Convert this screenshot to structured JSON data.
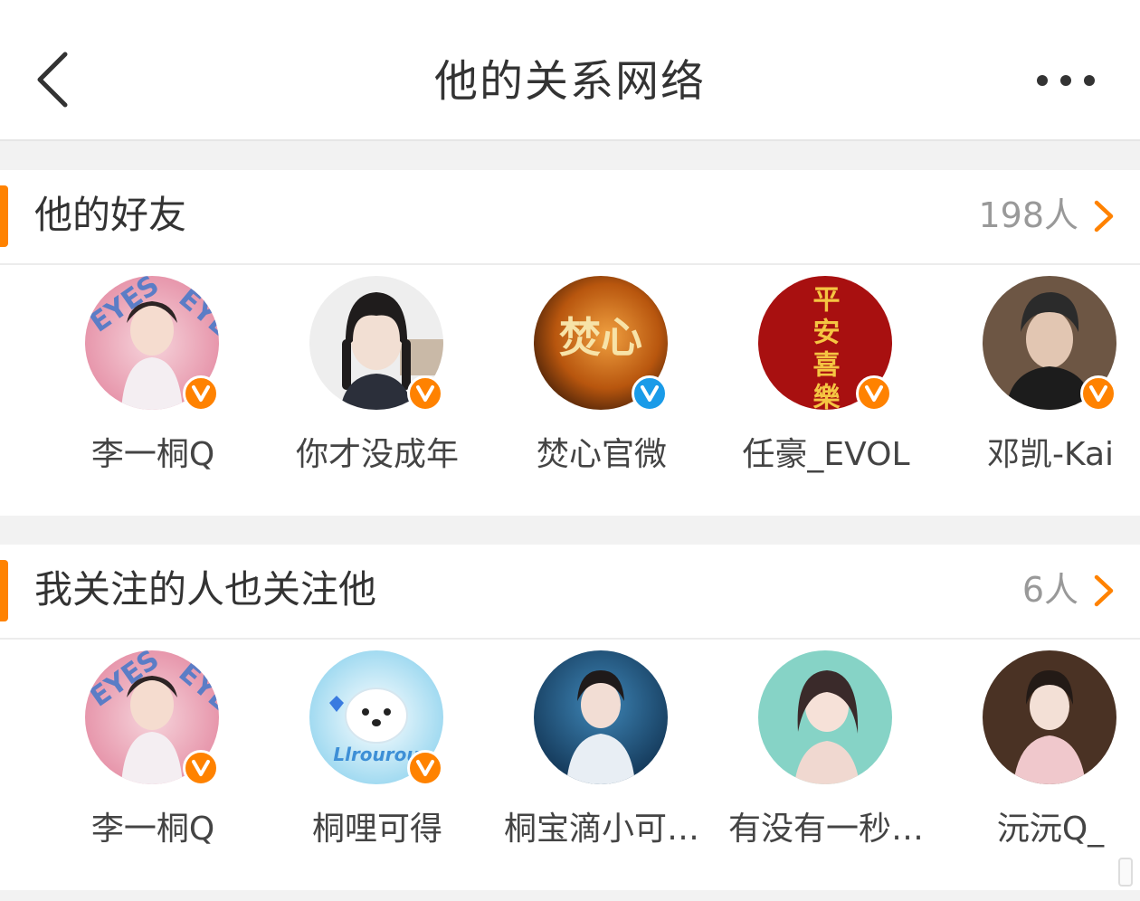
{
  "header": {
    "title": "他的关系网络",
    "back_icon": "chevron-left-icon",
    "more_icon": "more-dots-icon"
  },
  "colors": {
    "accent": "#ff8200",
    "verified_orange": "#ff8200",
    "verified_blue": "#1a9be8",
    "count_gray": "#999999"
  },
  "friends": {
    "title": "他的好友",
    "count": "198人",
    "users": [
      {
        "name": "李一桐Q",
        "badge": "V",
        "badge_color": "orange"
      },
      {
        "name": "你才没成年",
        "badge": "V",
        "badge_color": "orange"
      },
      {
        "name": "焚心官微",
        "badge": "V",
        "badge_color": "blue"
      },
      {
        "name": "任豪_EVOL",
        "badge": "V",
        "badge_color": "orange"
      },
      {
        "name": "邓凯-Kai",
        "badge": "V",
        "badge_color": "orange"
      }
    ]
  },
  "mutual": {
    "title": "我关注的人也关注他",
    "count": "6人",
    "users": [
      {
        "name": "李一桐Q",
        "badge": "V",
        "badge_color": "orange"
      },
      {
        "name": "桐哩可得",
        "badge": "V",
        "badge_color": "orange"
      },
      {
        "name": "桐宝滴小可…",
        "badge": "",
        "badge_color": ""
      },
      {
        "name": "有没有一秒…",
        "badge": "",
        "badge_color": ""
      },
      {
        "name": "沅沅Q_",
        "badge": "",
        "badge_color": ""
      }
    ]
  },
  "avatar_art": {
    "fenxin_text": "焚心",
    "pingan_text": "平安喜樂",
    "llrourou_text": "Llrourou",
    "eyes_text": "EYES"
  }
}
